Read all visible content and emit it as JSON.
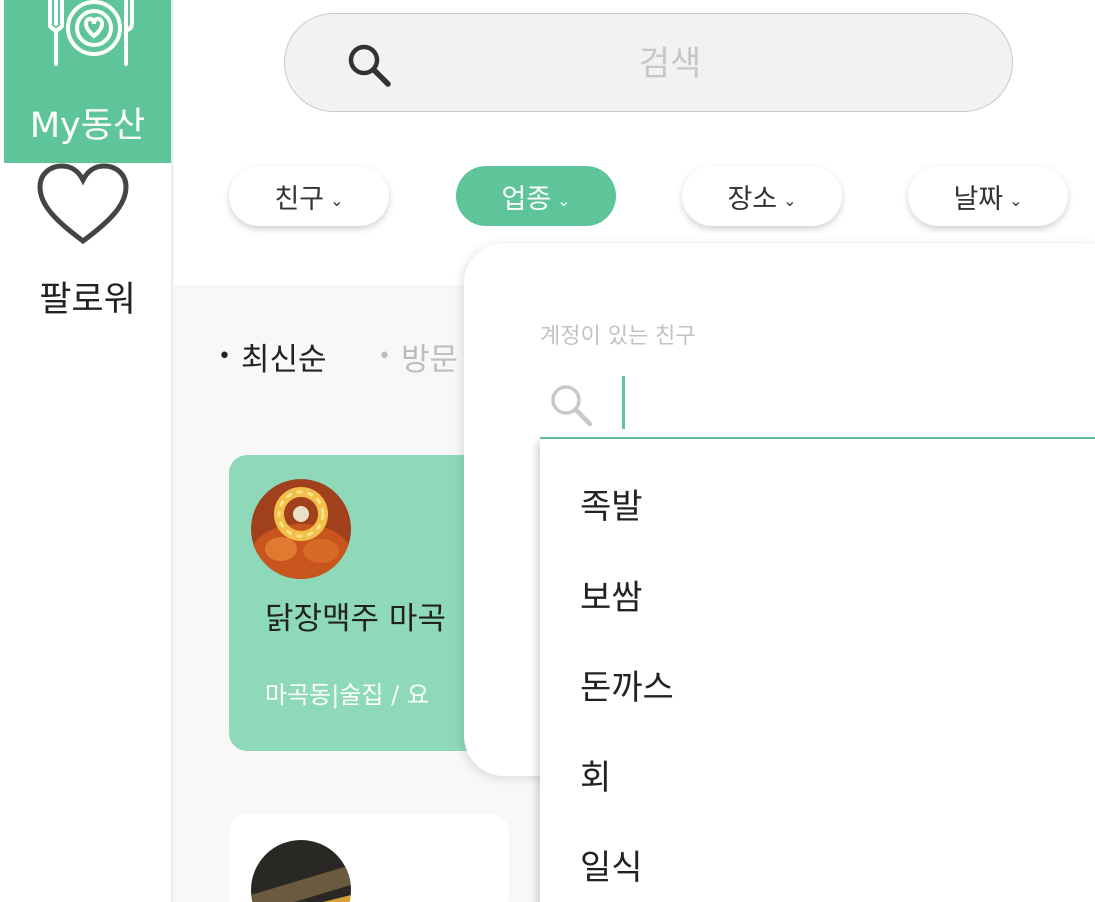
{
  "sidebar": {
    "items": [
      {
        "label": "My동산",
        "icon": "plate-heart-icon",
        "active": true
      },
      {
        "label": "팔로워",
        "icon": "heart-outline-icon",
        "active": false
      }
    ]
  },
  "search": {
    "placeholder": "검색",
    "icon": "search-icon"
  },
  "filters": [
    {
      "label": "친구",
      "active": false
    },
    {
      "label": "업종",
      "active": true
    },
    {
      "label": "장소",
      "active": false
    },
    {
      "label": "날짜",
      "active": false
    }
  ],
  "sort": {
    "active": "최신순",
    "other": "방문"
  },
  "cards": [
    {
      "title": "닭장맥주 마곡",
      "sub": "마곡동|술집 / 요"
    }
  ],
  "dropdown": {
    "label": "계정이 있는 친구",
    "search_value": "",
    "options": [
      "족발",
      "보쌈",
      "돈까스",
      "회",
      "일식"
    ]
  },
  "colors": {
    "accent": "#5ec59a",
    "card": "#8fd9bb"
  }
}
